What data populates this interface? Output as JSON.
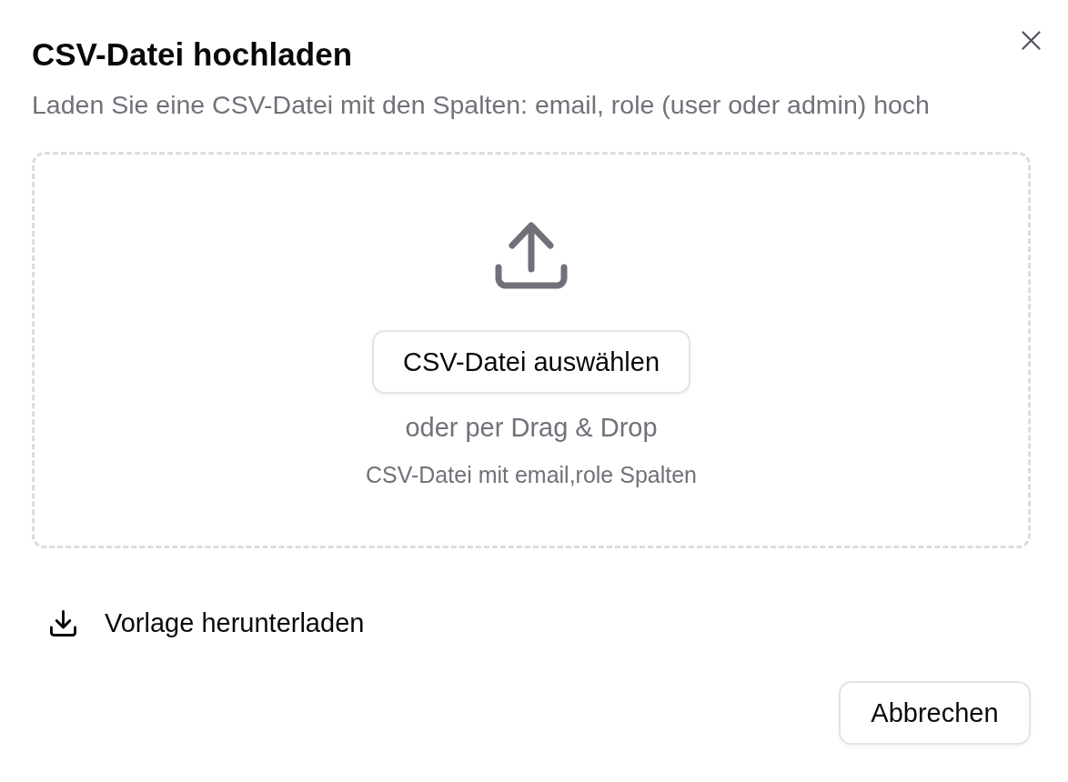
{
  "dialog": {
    "title": "CSV-Datei hochladen",
    "description": "Laden Sie eine CSV-Datei mit den Spalten: email, role (user oder admin) hoch",
    "dropzone": {
      "button": "CSV-Datei auswählen",
      "hint": "oder per Drag & Drop",
      "note": "CSV-Datei mit email,role Spalten"
    },
    "template_link": "Vorlage herunterladen",
    "buttons": [
      "Abbrechen"
    ]
  }
}
